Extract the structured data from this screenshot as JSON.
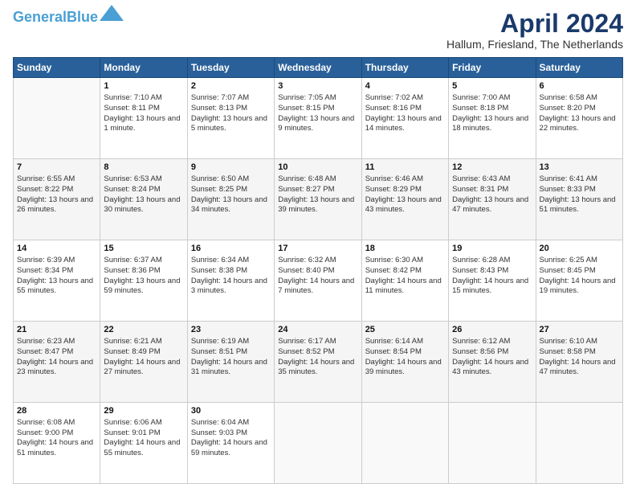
{
  "header": {
    "logo_line1": "General",
    "logo_line2": "Blue",
    "title": "April 2024",
    "subtitle": "Hallum, Friesland, The Netherlands"
  },
  "weekdays": [
    "Sunday",
    "Monday",
    "Tuesday",
    "Wednesday",
    "Thursday",
    "Friday",
    "Saturday"
  ],
  "weeks": [
    [
      {
        "day": "",
        "empty": true
      },
      {
        "day": "1",
        "sunrise": "Sunrise: 7:10 AM",
        "sunset": "Sunset: 8:11 PM",
        "daylight": "Daylight: 13 hours and 1 minute."
      },
      {
        "day": "2",
        "sunrise": "Sunrise: 7:07 AM",
        "sunset": "Sunset: 8:13 PM",
        "daylight": "Daylight: 13 hours and 5 minutes."
      },
      {
        "day": "3",
        "sunrise": "Sunrise: 7:05 AM",
        "sunset": "Sunset: 8:15 PM",
        "daylight": "Daylight: 13 hours and 9 minutes."
      },
      {
        "day": "4",
        "sunrise": "Sunrise: 7:02 AM",
        "sunset": "Sunset: 8:16 PM",
        "daylight": "Daylight: 13 hours and 14 minutes."
      },
      {
        "day": "5",
        "sunrise": "Sunrise: 7:00 AM",
        "sunset": "Sunset: 8:18 PM",
        "daylight": "Daylight: 13 hours and 18 minutes."
      },
      {
        "day": "6",
        "sunrise": "Sunrise: 6:58 AM",
        "sunset": "Sunset: 8:20 PM",
        "daylight": "Daylight: 13 hours and 22 minutes."
      }
    ],
    [
      {
        "day": "7",
        "sunrise": "Sunrise: 6:55 AM",
        "sunset": "Sunset: 8:22 PM",
        "daylight": "Daylight: 13 hours and 26 minutes."
      },
      {
        "day": "8",
        "sunrise": "Sunrise: 6:53 AM",
        "sunset": "Sunset: 8:24 PM",
        "daylight": "Daylight: 13 hours and 30 minutes."
      },
      {
        "day": "9",
        "sunrise": "Sunrise: 6:50 AM",
        "sunset": "Sunset: 8:25 PM",
        "daylight": "Daylight: 13 hours and 34 minutes."
      },
      {
        "day": "10",
        "sunrise": "Sunrise: 6:48 AM",
        "sunset": "Sunset: 8:27 PM",
        "daylight": "Daylight: 13 hours and 39 minutes."
      },
      {
        "day": "11",
        "sunrise": "Sunrise: 6:46 AM",
        "sunset": "Sunset: 8:29 PM",
        "daylight": "Daylight: 13 hours and 43 minutes."
      },
      {
        "day": "12",
        "sunrise": "Sunrise: 6:43 AM",
        "sunset": "Sunset: 8:31 PM",
        "daylight": "Daylight: 13 hours and 47 minutes."
      },
      {
        "day": "13",
        "sunrise": "Sunrise: 6:41 AM",
        "sunset": "Sunset: 8:33 PM",
        "daylight": "Daylight: 13 hours and 51 minutes."
      }
    ],
    [
      {
        "day": "14",
        "sunrise": "Sunrise: 6:39 AM",
        "sunset": "Sunset: 8:34 PM",
        "daylight": "Daylight: 13 hours and 55 minutes."
      },
      {
        "day": "15",
        "sunrise": "Sunrise: 6:37 AM",
        "sunset": "Sunset: 8:36 PM",
        "daylight": "Daylight: 13 hours and 59 minutes."
      },
      {
        "day": "16",
        "sunrise": "Sunrise: 6:34 AM",
        "sunset": "Sunset: 8:38 PM",
        "daylight": "Daylight: 14 hours and 3 minutes."
      },
      {
        "day": "17",
        "sunrise": "Sunrise: 6:32 AM",
        "sunset": "Sunset: 8:40 PM",
        "daylight": "Daylight: 14 hours and 7 minutes."
      },
      {
        "day": "18",
        "sunrise": "Sunrise: 6:30 AM",
        "sunset": "Sunset: 8:42 PM",
        "daylight": "Daylight: 14 hours and 11 minutes."
      },
      {
        "day": "19",
        "sunrise": "Sunrise: 6:28 AM",
        "sunset": "Sunset: 8:43 PM",
        "daylight": "Daylight: 14 hours and 15 minutes."
      },
      {
        "day": "20",
        "sunrise": "Sunrise: 6:25 AM",
        "sunset": "Sunset: 8:45 PM",
        "daylight": "Daylight: 14 hours and 19 minutes."
      }
    ],
    [
      {
        "day": "21",
        "sunrise": "Sunrise: 6:23 AM",
        "sunset": "Sunset: 8:47 PM",
        "daylight": "Daylight: 14 hours and 23 minutes."
      },
      {
        "day": "22",
        "sunrise": "Sunrise: 6:21 AM",
        "sunset": "Sunset: 8:49 PM",
        "daylight": "Daylight: 14 hours and 27 minutes."
      },
      {
        "day": "23",
        "sunrise": "Sunrise: 6:19 AM",
        "sunset": "Sunset: 8:51 PM",
        "daylight": "Daylight: 14 hours and 31 minutes."
      },
      {
        "day": "24",
        "sunrise": "Sunrise: 6:17 AM",
        "sunset": "Sunset: 8:52 PM",
        "daylight": "Daylight: 14 hours and 35 minutes."
      },
      {
        "day": "25",
        "sunrise": "Sunrise: 6:14 AM",
        "sunset": "Sunset: 8:54 PM",
        "daylight": "Daylight: 14 hours and 39 minutes."
      },
      {
        "day": "26",
        "sunrise": "Sunrise: 6:12 AM",
        "sunset": "Sunset: 8:56 PM",
        "daylight": "Daylight: 14 hours and 43 minutes."
      },
      {
        "day": "27",
        "sunrise": "Sunrise: 6:10 AM",
        "sunset": "Sunset: 8:58 PM",
        "daylight": "Daylight: 14 hours and 47 minutes."
      }
    ],
    [
      {
        "day": "28",
        "sunrise": "Sunrise: 6:08 AM",
        "sunset": "Sunset: 9:00 PM",
        "daylight": "Daylight: 14 hours and 51 minutes."
      },
      {
        "day": "29",
        "sunrise": "Sunrise: 6:06 AM",
        "sunset": "Sunset: 9:01 PM",
        "daylight": "Daylight: 14 hours and 55 minutes."
      },
      {
        "day": "30",
        "sunrise": "Sunrise: 6:04 AM",
        "sunset": "Sunset: 9:03 PM",
        "daylight": "Daylight: 14 hours and 59 minutes."
      },
      {
        "day": "",
        "empty": true
      },
      {
        "day": "",
        "empty": true
      },
      {
        "day": "",
        "empty": true
      },
      {
        "day": "",
        "empty": true
      }
    ]
  ]
}
